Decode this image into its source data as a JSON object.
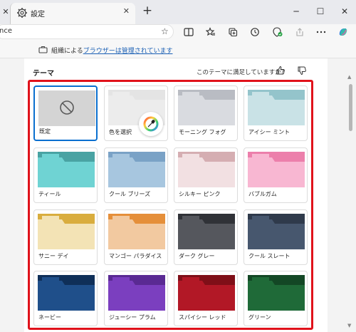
{
  "tab": {
    "title": "設定"
  },
  "address": {
    "text": "nce"
  },
  "banner": {
    "prefix": "組織による",
    "link": "ブラウザーは管理されています"
  },
  "section": {
    "title": "テーマ",
    "feedback": "このテーマに満足していますか?"
  },
  "themes": [
    {
      "name": "既定",
      "color": "#d4d4d4",
      "tab": "#d4d4d4",
      "selected": true
    },
    {
      "name": "色を選択",
      "color": "#ececec",
      "tab": "#e4e4e4"
    },
    {
      "name": "モーニング フォグ",
      "color": "#d9dbe0",
      "tab": "#b9bcc3"
    },
    {
      "name": "アイシー ミント",
      "color": "#c9e2e6",
      "tab": "#94c4cb"
    },
    {
      "name": "ティール",
      "color": "#6fd3d3",
      "tab": "#49a3a3"
    },
    {
      "name": "クール ブリーズ",
      "color": "#a7c6df",
      "tab": "#7aa2c6"
    },
    {
      "name": "シルキー ピンク",
      "color": "#f2e0e2",
      "tab": "#d5aeb2"
    },
    {
      "name": "バブルガム",
      "color": "#f8b7d2",
      "tab": "#ec7fab"
    },
    {
      "name": "サニー デイ",
      "color": "#f3e3b5",
      "tab": "#d9ad3e"
    },
    {
      "name": "マンゴー パラダイス",
      "color": "#f2c9a0",
      "tab": "#e58f3a"
    },
    {
      "name": "ダーク グレー",
      "color": "#55575d",
      "tab": "#303237"
    },
    {
      "name": "クール スレート",
      "color": "#47576e",
      "tab": "#2f3a4b"
    },
    {
      "name": "ネービー",
      "color": "#1f4f8a",
      "tab": "#0f2f58"
    },
    {
      "name": "ジューシー プラム",
      "color": "#7b3fbf",
      "tab": "#5a2a93"
    },
    {
      "name": "スパイシー レッド",
      "color": "#b21826",
      "tab": "#7f0f18"
    },
    {
      "name": "グリーン",
      "color": "#1f6a38",
      "tab": "#134725"
    }
  ]
}
